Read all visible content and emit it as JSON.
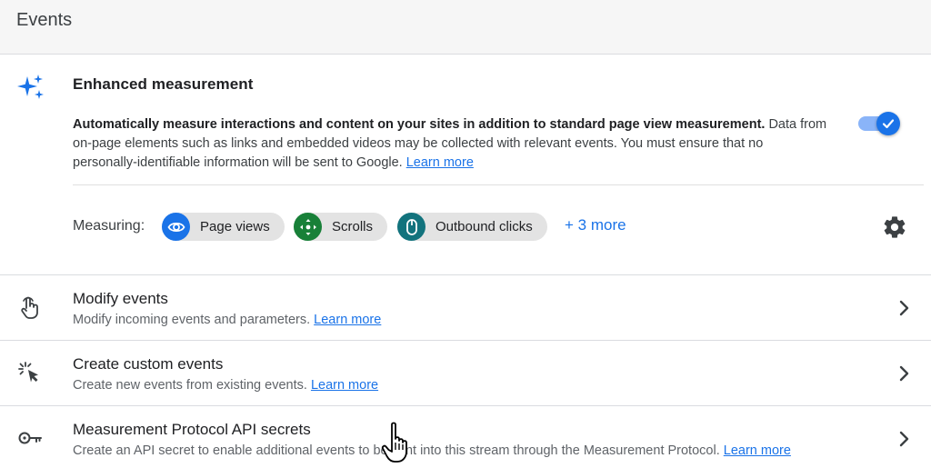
{
  "header": {
    "title": "Events"
  },
  "enhanced_measurement": {
    "title": "Enhanced measurement",
    "description_lead": "Automatically measure interactions and content on your sites in addition to standard page view measurement.",
    "description_body": "Data from on-page elements such as links and embedded videos may be collected with relevant events. You must ensure that no personally-identifiable information will be sent to Google.",
    "learn_more": "Learn more",
    "toggle_on": true,
    "measuring_label": "Measuring:",
    "chips": [
      {
        "label": "Page views",
        "icon": "eye-icon",
        "color": "#1a73e8"
      },
      {
        "label": "Scrolls",
        "icon": "scroll-arrows-icon",
        "color": "#188038"
      },
      {
        "label": "Outbound clicks",
        "icon": "mouse-icon",
        "color": "#12737d"
      }
    ],
    "more_link": "+ 3 more",
    "settings_icon": "gear-icon"
  },
  "rows": [
    {
      "title": "Modify events",
      "description": "Modify incoming events and parameters.",
      "learn_more": "Learn more",
      "icon": "touch-hand-icon"
    },
    {
      "title": "Create custom events",
      "description": "Create new events from existing events.",
      "learn_more": "Learn more",
      "icon": "cursor-click-icon"
    },
    {
      "title": "Measurement Protocol API secrets",
      "description": "Create an API secret to enable additional events to be sent into this stream through the Measurement Protocol.",
      "learn_more": "Learn more",
      "icon": "key-icon"
    }
  ],
  "colors": {
    "accent": "#1a73e8",
    "toggle_track": "#8ab4f8",
    "divider": "#dadce0"
  }
}
